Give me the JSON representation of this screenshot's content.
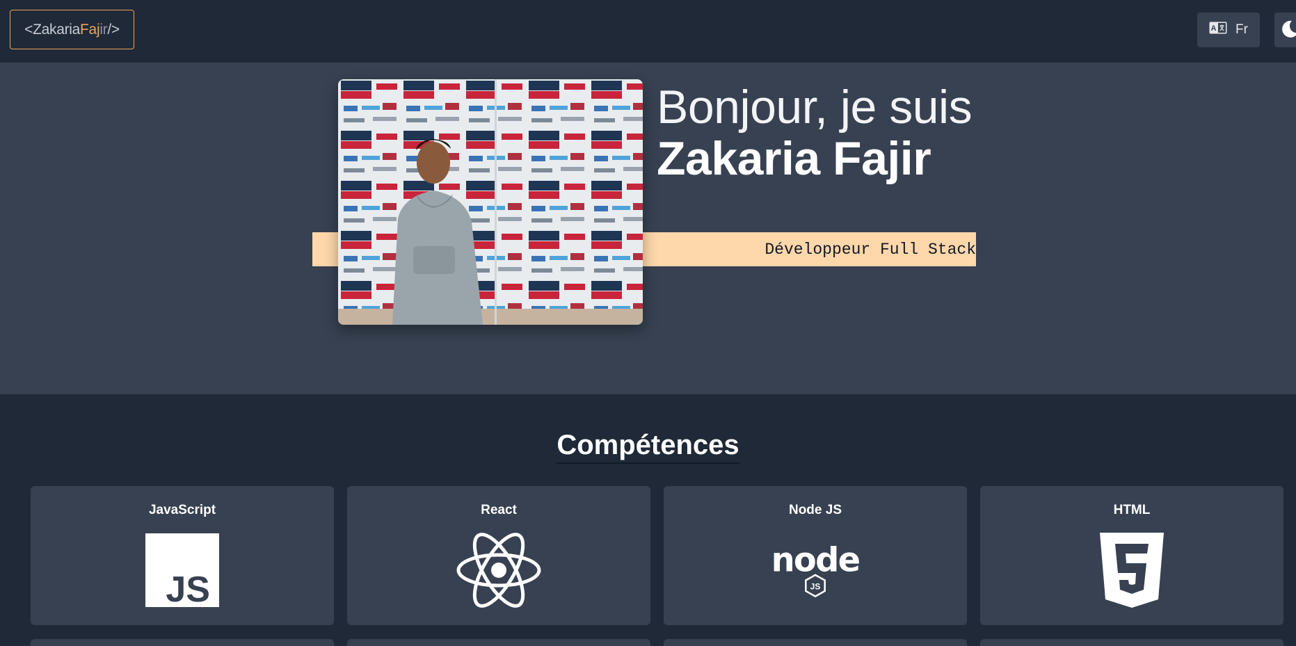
{
  "nav": {
    "logo": {
      "open": "<",
      "first": "Zakaria",
      "middle": "Faj",
      "last": "ir",
      "close": "/>"
    },
    "lang_label": "Fr",
    "lang_icon": "translate-icon",
    "theme_icon": "moon-icon"
  },
  "hero": {
    "greeting": "Bonjour, je suis",
    "name": "Zakaria Fajir",
    "job_title": "Développeur Full Stack",
    "photo_alt": "profile-photo"
  },
  "skills": {
    "title": "Compétences",
    "items": [
      {
        "label": "JavaScript",
        "icon": "javascript-icon"
      },
      {
        "label": "React",
        "icon": "react-icon"
      },
      {
        "label": "Node JS",
        "icon": "nodejs-icon"
      },
      {
        "label": "HTML",
        "icon": "html5-icon"
      }
    ]
  },
  "colors": {
    "background": "#1f2937",
    "surface": "#374151",
    "accent": "#f0a35a",
    "ribbon": "#fed7aa"
  }
}
